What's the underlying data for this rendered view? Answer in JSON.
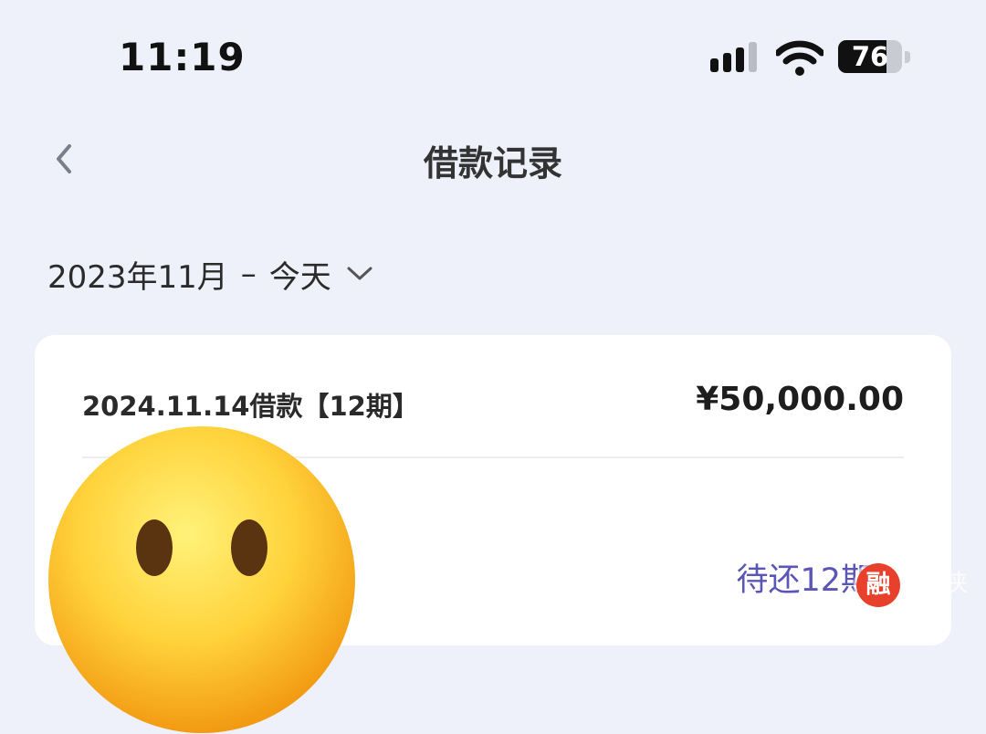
{
  "status_bar": {
    "time": "11:19",
    "battery_level": "76",
    "battery_fraction": 0.76,
    "icons": [
      "cellular-signal-icon",
      "wifi-icon",
      "battery-icon"
    ]
  },
  "nav": {
    "back_icon": "chevron-left-icon",
    "title": "借款记录"
  },
  "filter": {
    "start": "2023年11月",
    "separator": "–",
    "end": "今天",
    "icon": "chevron-down-icon"
  },
  "loan_card": {
    "title": "2024.11.14借款【12期】",
    "amount": "¥50,000.00",
    "pending_label": "待还12期",
    "pending_icon": "chevron-right-icon"
  },
  "overlays": {
    "emoji": "neutral-face-emoji",
    "watermark_logo": "融",
    "watermark_text": "侠"
  },
  "colors": {
    "background": "#eef0fa",
    "card": "#ffffff",
    "accent": "#5b55b5",
    "watermark": "#e8412b"
  }
}
